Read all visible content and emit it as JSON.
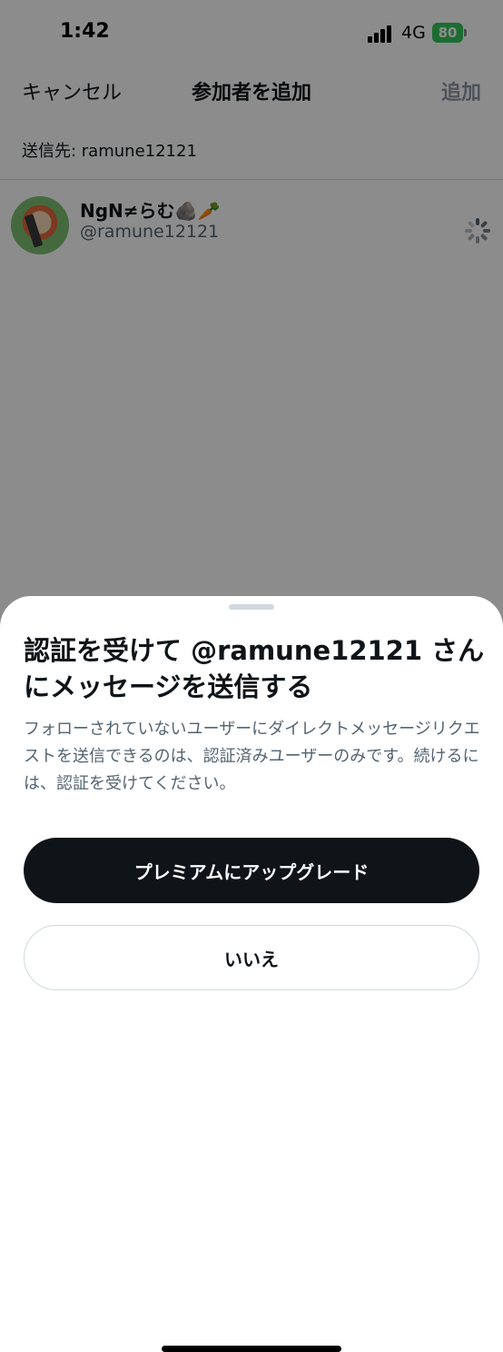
{
  "status_bar": {
    "time": "1:42",
    "network": "4G",
    "battery": "80",
    "battery_color": "#34c759"
  },
  "nav": {
    "cancel_label": "キャンセル",
    "title": "参加者を追加",
    "add_label": "追加"
  },
  "recipient": {
    "label": "送信先: ramune12121"
  },
  "user": {
    "display_name": "NgN≠らむ🪨🥕",
    "handle": "@ramune12121"
  },
  "sheet": {
    "title": "認証を受けて @ramune12121 さんにメッセージを送信する",
    "body": "フォローされていないユーザーにダイレクトメッセージリクエストを送信できるのは、認証済みユーザーのみです。続けるには、認証を受けてください。",
    "primary_button": "プレミアムにアップグレード",
    "secondary_button": "いいえ"
  },
  "colors": {
    "primary_button_bg": "#0f1419",
    "secondary_text": "#536471",
    "disabled_action": "#8b98a5"
  }
}
